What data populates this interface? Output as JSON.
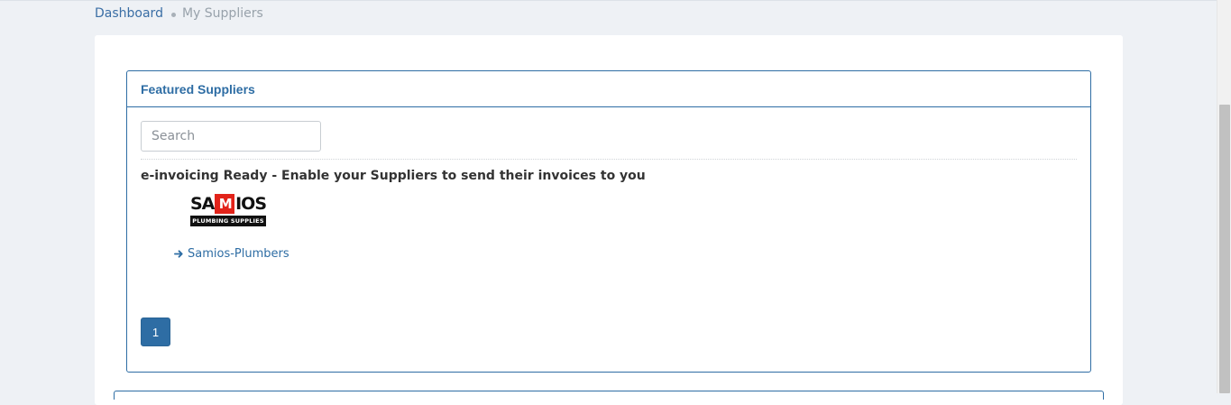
{
  "breadcrumb": {
    "home": "Dashboard",
    "current": "My Suppliers"
  },
  "panel": {
    "title": "Featured Suppliers",
    "search_placeholder": "Search",
    "section_title": "e-invoicing Ready - Enable your Suppliers to send their invoices to you"
  },
  "suppliers": [
    {
      "logo_text_left": "SA",
      "logo_text_mid": "M",
      "logo_text_right": "IOS",
      "logo_tagline": "PLUMBING SUPPLIES",
      "link_label": "Samios-Plumbers",
      "link_icon": "arrow-right-icon"
    }
  ],
  "pagination": {
    "current_page": "1"
  },
  "colors": {
    "accent": "#2e6da4",
    "background": "#eef1f5",
    "logo_red": "#e2231a"
  }
}
